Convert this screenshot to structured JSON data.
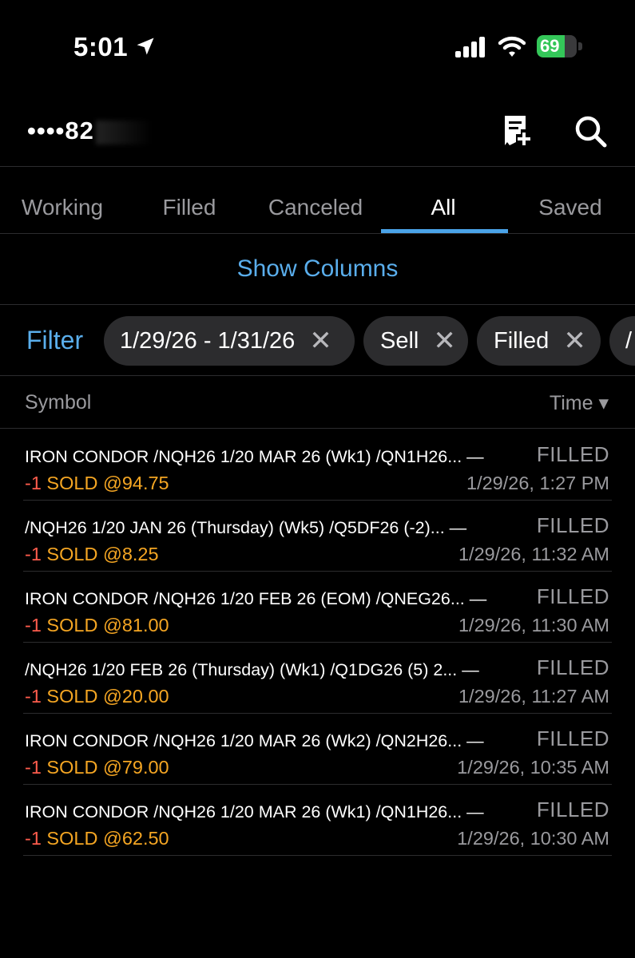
{
  "status_bar": {
    "time": "5:01",
    "battery": "69",
    "battery_level": 0.69
  },
  "header": {
    "account_masked": "••••82",
    "icons": [
      "order-add-icon",
      "search-icon"
    ]
  },
  "tabs": [
    {
      "label": "Working",
      "active": false
    },
    {
      "label": "Filled",
      "active": false
    },
    {
      "label": "Canceled",
      "active": false
    },
    {
      "label": "All",
      "active": true
    },
    {
      "label": "Saved",
      "active": false
    }
  ],
  "show_columns": "Show Columns",
  "filter": {
    "label": "Filter",
    "chips": [
      "1/29/26 - 1/31/26",
      "Sell",
      "Filled",
      "/"
    ]
  },
  "columns": {
    "symbol": "Symbol",
    "time": "Time ▾"
  },
  "orders": [
    {
      "title": "IRON CONDOR /NQH26 1/20 MAR 26 (Wk1) /QN1H26... —",
      "status": "FILLED",
      "qty": "-1",
      "action": " SOLD @94.75",
      "time": "1/29/26, 1:27 PM"
    },
    {
      "title": "/NQH26 1/20 JAN 26 (Thursday) (Wk5) /Q5DF26 (-2)... —",
      "status": "FILLED",
      "qty": "-1",
      "action": " SOLD @8.25",
      "time": "1/29/26, 11:32 AM"
    },
    {
      "title": "IRON CONDOR /NQH26 1/20 FEB 26 (EOM) /QNEG26... —",
      "status": "FILLED",
      "qty": "-1",
      "action": " SOLD @81.00",
      "time": "1/29/26, 11:30 AM"
    },
    {
      "title": "/NQH26 1/20 FEB 26 (Thursday) (Wk1) /Q1DG26 (5) 2... —",
      "status": "FILLED",
      "qty": "-1",
      "action": " SOLD @20.00",
      "time": "1/29/26, 11:27 AM"
    },
    {
      "title": "IRON CONDOR /NQH26 1/20 MAR 26 (Wk2) /QN2H26... —",
      "status": "FILLED",
      "qty": "-1",
      "action": " SOLD @79.00",
      "time": "1/29/26, 10:35 AM"
    },
    {
      "title": "IRON CONDOR /NQH26 1/20 MAR 26 (Wk1) /QN1H26... —",
      "status": "FILLED",
      "qty": "-1",
      "action": " SOLD @62.50",
      "time": "1/29/26, 10:30 AM"
    }
  ]
}
